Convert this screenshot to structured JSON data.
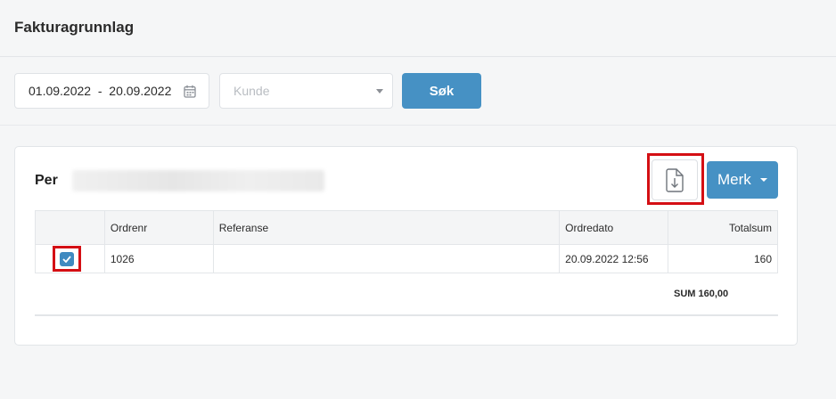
{
  "header": {
    "title": "Fakturagrunnlag"
  },
  "filters": {
    "date_range": "01.09.2022  -  20.09.2022",
    "customer_placeholder": "Kunde",
    "search_label": "Søk"
  },
  "card": {
    "customer_label": "Per",
    "mark_label": "Merk",
    "table": {
      "columns": [
        "",
        "Ordrenr",
        "Referanse",
        "Ordredato",
        "Totalsum"
      ],
      "rows": [
        {
          "checked": true,
          "order_no": "1026",
          "reference": "",
          "order_date": "20.09.2022 12:56",
          "total": "160"
        }
      ]
    },
    "sum_label": "SUM 160,00"
  },
  "colors": {
    "accent": "#4691c4",
    "highlight": "#d40f14"
  },
  "icons": {
    "export": "file-download-icon",
    "calendar": "calendar-icon",
    "check": "check-icon"
  }
}
